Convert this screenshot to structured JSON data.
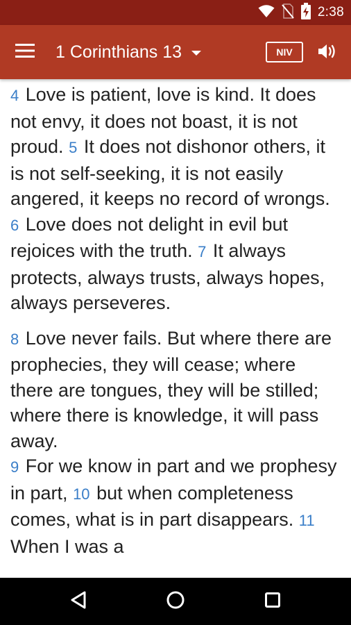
{
  "status_bar": {
    "time": "2:38",
    "icons": [
      "wifi-icon",
      "no-sim-icon",
      "battery-charging-icon"
    ]
  },
  "app_bar": {
    "menu_icon": "hamburger-menu-icon",
    "book_title": "1 Corinthians 13",
    "version_label": "NIV",
    "audio_icon": "speaker-icon"
  },
  "colors": {
    "status_bar": "#8a1f15",
    "app_bar": "#b03a24",
    "verse_number": "#3a7ec8",
    "text": "#222222"
  },
  "passage": {
    "paragraphs": [
      {
        "verses": [
          {
            "num": "4",
            "text": "Love is patient, love is kind. It does not envy, it does not boast, it is not proud."
          },
          {
            "num": "5",
            "text": "It does not dishonor others, it is not self-seeking, it is not easily angered, it keeps no record of wrongs."
          },
          {
            "num": "6",
            "text": "Love does not delight in evil but rejoices with the truth."
          },
          {
            "num": "7",
            "text": "It always protects, always trusts, always hopes, always perseveres."
          }
        ]
      },
      {
        "verses": [
          {
            "num": "8",
            "text": "Love never fails. But where there are prophecies, they will cease; where there are tongues, they will be stilled; where there is knowledge, it will pass away."
          },
          {
            "num": "9",
            "text": "For we know in part and we prophesy in part,"
          },
          {
            "num": "10",
            "text": "but when completeness comes, what is in part disappears."
          },
          {
            "num": "11",
            "text": "When I was a"
          }
        ]
      }
    ]
  },
  "nav_bar": {
    "back_icon": "back-triangle-icon",
    "home_icon": "home-circle-icon",
    "recents_icon": "recents-square-icon"
  }
}
